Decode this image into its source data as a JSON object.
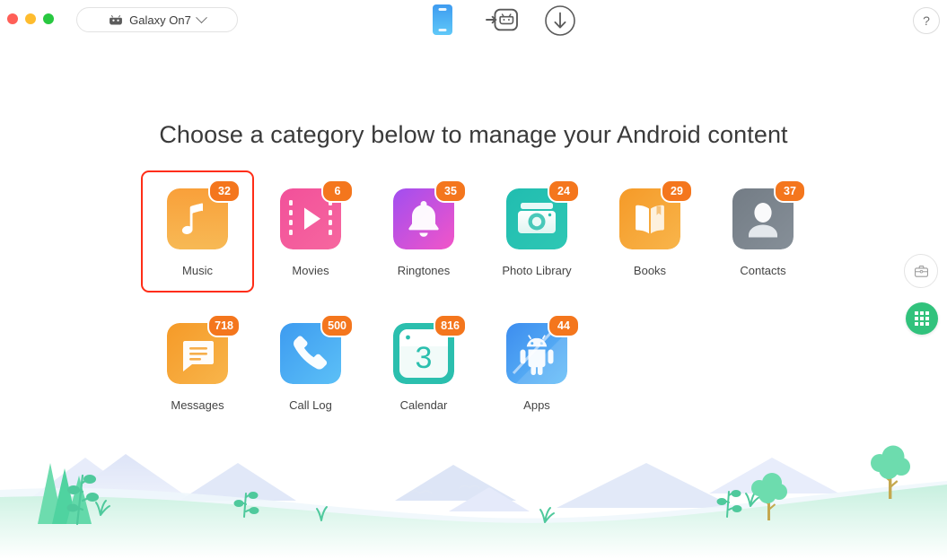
{
  "window": {
    "traffic_lights": [
      "close",
      "minimize",
      "zoom"
    ],
    "device": {
      "name": "Galaxy On7",
      "icon": "android-head-icon",
      "chevron": "chevron-down-icon"
    },
    "toolbar": [
      {
        "name": "device-view-icon",
        "label": "Device"
      },
      {
        "name": "transfer-to-android-icon",
        "label": "Transfer"
      },
      {
        "name": "download-icon",
        "label": "Download"
      }
    ],
    "help_label": "?"
  },
  "main": {
    "heading": "Choose a category below to manage your Android content"
  },
  "categories": [
    {
      "label": "Music",
      "badge": "32",
      "icon": "music-note-icon",
      "selected": true
    },
    {
      "label": "Movies",
      "badge": "6",
      "icon": "film-play-icon",
      "selected": false
    },
    {
      "label": "Ringtones",
      "badge": "35",
      "icon": "bell-icon",
      "selected": false
    },
    {
      "label": "Photo Library",
      "badge": "24",
      "icon": "camera-icon",
      "selected": false
    },
    {
      "label": "Books",
      "badge": "29",
      "icon": "open-book-icon",
      "selected": false
    },
    {
      "label": "Contacts",
      "badge": "37",
      "icon": "person-icon",
      "selected": false
    },
    {
      "label": "Messages",
      "badge": "718",
      "icon": "speech-bubble-icon",
      "selected": false
    },
    {
      "label": "Call Log",
      "badge": "500",
      "icon": "phone-handset-icon",
      "selected": false
    },
    {
      "label": "Calendar",
      "badge": "816",
      "icon": "calendar-icon",
      "day": "3",
      "selected": false
    },
    {
      "label": "Apps",
      "badge": "44",
      "icon": "android-robot-icon",
      "selected": false
    }
  ],
  "side_buttons": [
    {
      "name": "toolbox-button",
      "icon": "toolbox-icon"
    },
    {
      "name": "app-grid-button",
      "icon": "grid-icon"
    }
  ],
  "colors": {
    "selection": "#ff2d17",
    "badge": "#f4761d",
    "fab": "#31c27c",
    "background": "#ffffff"
  }
}
